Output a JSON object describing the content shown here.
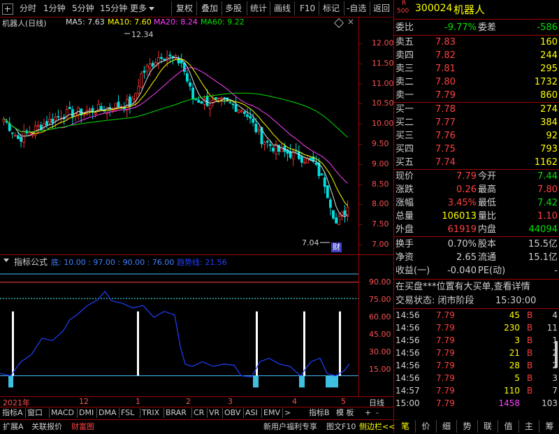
{
  "toolbar": {
    "period_tabs": [
      "分时",
      "1分钟",
      "5分钟",
      "15分钟",
      "更多"
    ],
    "actions": [
      "复权",
      "叠加",
      "多股",
      "统计",
      "画线",
      "F10",
      "标记",
      "-自选",
      "返回"
    ]
  },
  "chart_header": {
    "title": "机器人(日线)",
    "ma5": "MA5: 7.63",
    "ma10": "MA10: 7.60",
    "ma20": "MA20: 8.24",
    "ma60": "MA60: 9.22",
    "high_label": "12.34",
    "low_label": "7.04",
    "cai_badge": "财"
  },
  "price_axis": [
    "12.00",
    "11.50",
    "11.00",
    "10.50",
    "10.00",
    "9.50",
    "9.00",
    "8.50",
    "8.00",
    "7.50",
    "7.00"
  ],
  "indicator": {
    "title": "指标公式",
    "params_label": "底: 10.00 : 97.00 : 90.00 : 76.00",
    "trend_label": "趋势线: 21.56",
    "axis": [
      "90.00",
      "75.00",
      "60.00",
      "45.00",
      "30.00",
      "15.00"
    ]
  },
  "date_axis": [
    "2021年",
    "12",
    "1",
    "2",
    "3",
    "4",
    "5"
  ],
  "date_axis_right": "日线",
  "indicator_tabs": [
    "指标A",
    "窗口",
    "MACD",
    "DMI",
    "DMA",
    "FSL",
    "TRIX",
    "BRAR",
    "CR",
    "VR",
    "OBV",
    "ASI",
    "EMV",
    ">"
  ],
  "indicator_tabs_right": [
    "指标B",
    "模 板",
    "+",
    "-"
  ],
  "bottom_tabs": [
    "扩展A",
    "关联报价",
    "财富图"
  ],
  "bottom_promo": "新用户福利专享",
  "bottom_extra": [
    "图文F10",
    "侧边栏<<"
  ],
  "quote": {
    "code": "300024",
    "name": "机器人",
    "badge_top": "R",
    "badge_bottom": "500",
    "weibi_label": "委比",
    "weibi": "-9.77%",
    "weicha_label": "委差",
    "weicha": "-586",
    "asks": [
      {
        "label": "卖五",
        "price": "7.83",
        "vol": "160"
      },
      {
        "label": "卖四",
        "price": "7.82",
        "vol": "244"
      },
      {
        "label": "卖三",
        "price": "7.81",
        "vol": "295"
      },
      {
        "label": "卖二",
        "price": "7.80",
        "vol": "1732"
      },
      {
        "label": "卖一",
        "price": "7.79",
        "vol": "860"
      }
    ],
    "bids": [
      {
        "label": "买一",
        "price": "7.78",
        "vol": "274"
      },
      {
        "label": "买二",
        "price": "7.77",
        "vol": "384"
      },
      {
        "label": "买三",
        "price": "7.76",
        "vol": "92"
      },
      {
        "label": "买四",
        "price": "7.75",
        "vol": "793"
      },
      {
        "label": "买五",
        "price": "7.74",
        "vol": "1162"
      }
    ],
    "stats": [
      {
        "l1": "现价",
        "v1": "7.79",
        "c1": "#ff4040",
        "l2": "今开",
        "v2": "7.44",
        "c2": "#00e000"
      },
      {
        "l1": "涨跌",
        "v1": "0.26",
        "c1": "#ff4040",
        "l2": "最高",
        "v2": "7.80",
        "c2": "#ff4040"
      },
      {
        "l1": "涨幅",
        "v1": "3.45%",
        "c1": "#ff4040",
        "l2": "最低",
        "v2": "7.42",
        "c2": "#00e000"
      },
      {
        "l1": "总量",
        "v1": "106013",
        "c1": "#ffff00",
        "l2": "量比",
        "v2": "1.10",
        "c2": "#ff4040"
      },
      {
        "l1": "外盘",
        "v1": "61919",
        "c1": "#ff4040",
        "l2": "内盘",
        "v2": "44094",
        "c2": "#00e000"
      }
    ],
    "stats2": [
      {
        "l1": "换手",
        "v1": "0.70%",
        "l2": "股本",
        "v2": "15.5亿"
      },
      {
        "l1": "净资",
        "v1": "2.65",
        "l2": "流通",
        "v2": "15.1亿"
      },
      {
        "l1": "收益(一)",
        "v1": "-0.040",
        "l2": "PE(动)",
        "v2": "-"
      }
    ],
    "notice": "在买盘***位置有大买单,查看详情",
    "status_label": "交易状态: 闭市阶段",
    "status_time": "15:30:00",
    "trades": [
      {
        "t": "14:56",
        "p": "7.79",
        "v": "45",
        "d": "B",
        "n": "4"
      },
      {
        "t": "14:56",
        "p": "7.79",
        "v": "230",
        "d": "B",
        "n": "11"
      },
      {
        "t": "14:56",
        "p": "7.79",
        "v": "3",
        "d": "B",
        "n": "1"
      },
      {
        "t": "14:56",
        "p": "7.79",
        "v": "21",
        "d": "B",
        "n": "2"
      },
      {
        "t": "14:56",
        "p": "7.79",
        "v": "28",
        "d": "B",
        "n": "2"
      },
      {
        "t": "14:56",
        "p": "7.79",
        "v": "5",
        "d": "B",
        "n": "3"
      },
      {
        "t": "14:57",
        "p": "7.79",
        "v": "110",
        "d": "B",
        "n": "7"
      },
      {
        "t": "15:00",
        "p": "7.79",
        "v": "1458",
        "d": "",
        "n": "103"
      }
    ],
    "bottom_tabs": [
      "笔",
      "价",
      "细",
      "势",
      "联",
      "值",
      "主",
      "筹"
    ]
  },
  "colors": {
    "up": "#ff4040",
    "down": "#00e000",
    "axis": "#a00000",
    "accent": "#ffff00"
  }
}
